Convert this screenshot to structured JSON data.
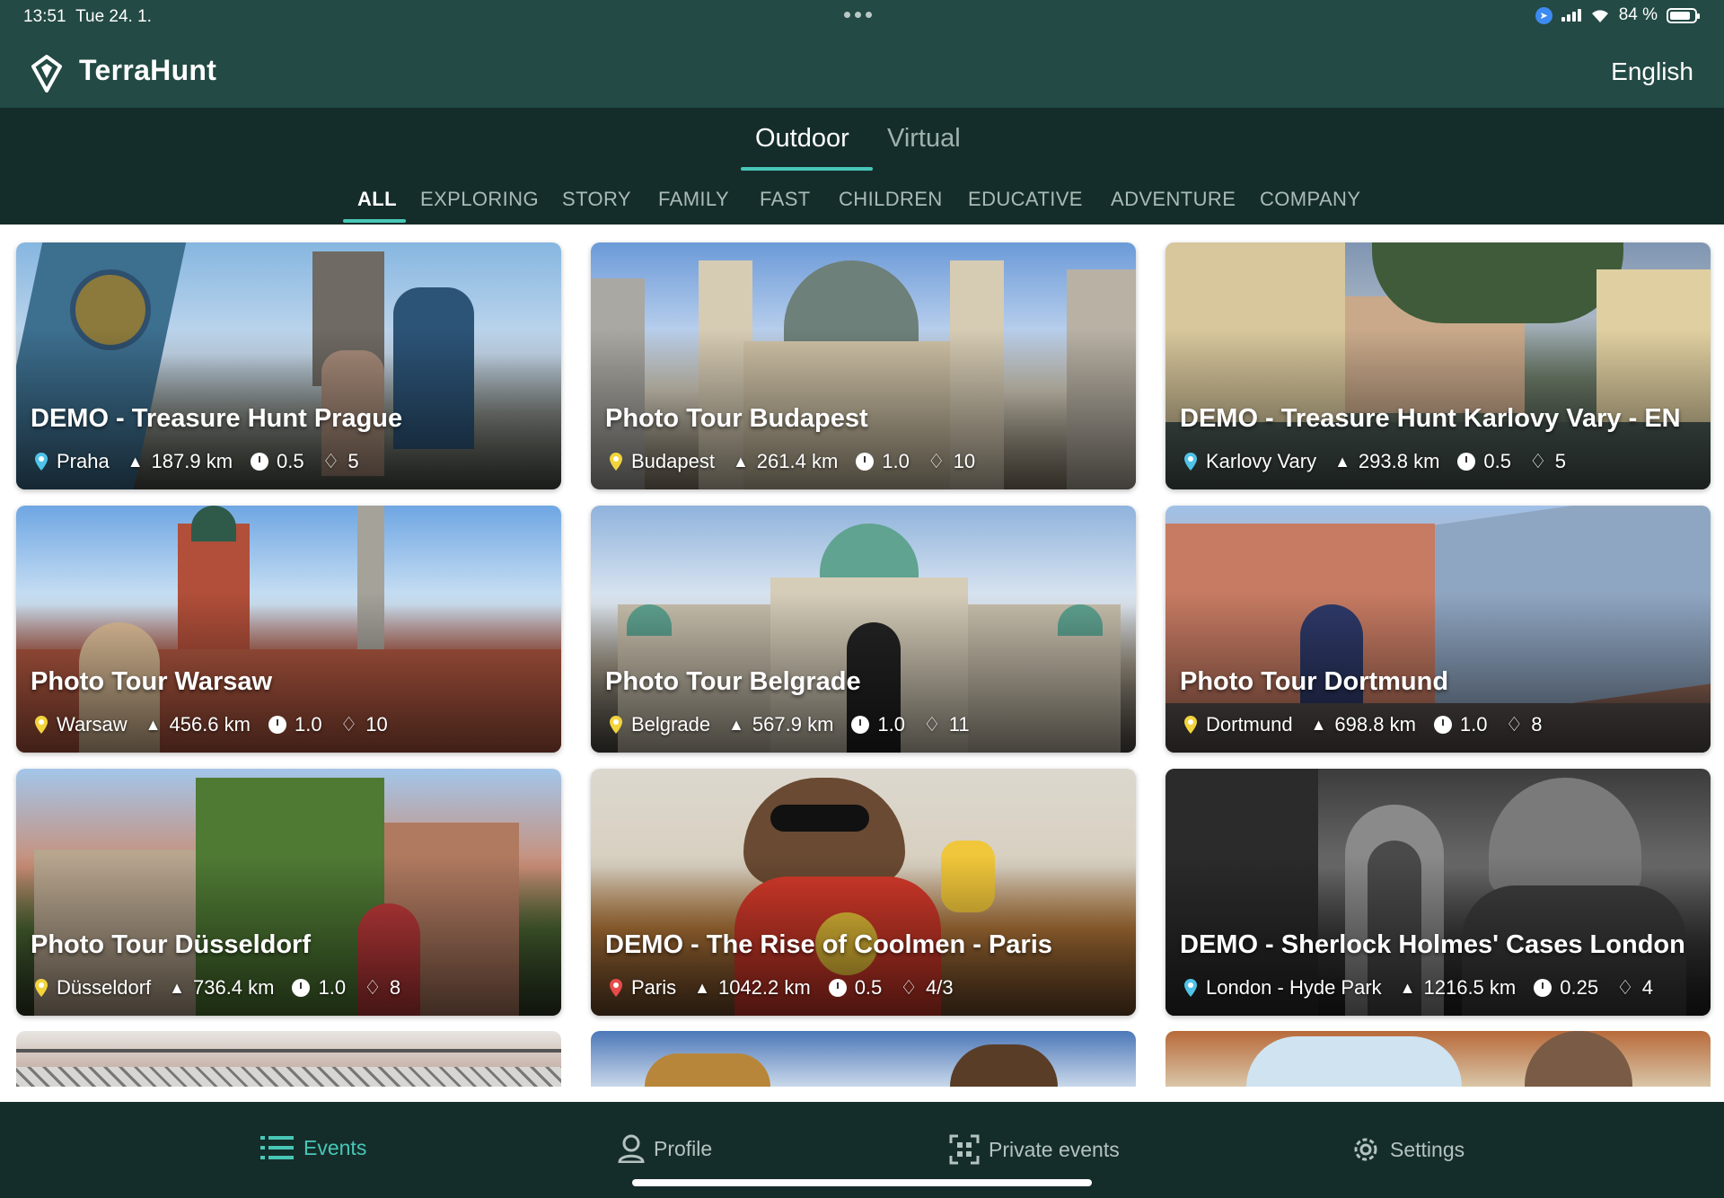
{
  "status": {
    "time": "13:51",
    "date": "Tue 24. 1.",
    "battery": "84 %",
    "battery_level": 0.84
  },
  "header": {
    "app_name": "TerraHunt",
    "language": "English"
  },
  "main_tabs": [
    {
      "label": "Outdoor",
      "active": true
    },
    {
      "label": "Virtual",
      "active": false
    }
  ],
  "categories": [
    {
      "label": "ALL",
      "active": true
    },
    {
      "label": "EXPLORING"
    },
    {
      "label": "STORY"
    },
    {
      "label": "FAMILY"
    },
    {
      "label": "FAST"
    },
    {
      "label": "CHILDREN"
    },
    {
      "label": "EDUCATIVE"
    },
    {
      "label": "ADVENTURE"
    },
    {
      "label": "COMPANY"
    }
  ],
  "cards": [
    {
      "title": "DEMO - Treasure Hunt Prague",
      "location": "Praha",
      "distance": "187.9 km",
      "duration": "0.5",
      "points": "5",
      "pin_color": "#4fc3e8"
    },
    {
      "title": "Photo Tour Budapest",
      "location": "Budapest",
      "distance": "261.4 km",
      "duration": "1.0",
      "points": "10",
      "pin_color": "#f2d43c"
    },
    {
      "title": "DEMO - Treasure Hunt Karlovy Vary - EN",
      "location": "Karlovy Vary",
      "distance": "293.8 km",
      "duration": "0.5",
      "points": "5",
      "pin_color": "#4fc3e8"
    },
    {
      "title": "Photo Tour Warsaw",
      "location": "Warsaw",
      "distance": "456.6 km",
      "duration": "1.0",
      "points": "10",
      "pin_color": "#f2d43c"
    },
    {
      "title": "Photo Tour Belgrade",
      "location": "Belgrade",
      "distance": "567.9 km",
      "duration": "1.0",
      "points": "11",
      "pin_color": "#f2d43c"
    },
    {
      "title": "Photo Tour Dortmund",
      "location": "Dortmund",
      "distance": "698.8 km",
      "duration": "1.0",
      "points": "8",
      "pin_color": "#f2d43c"
    },
    {
      "title": "Photo Tour Düsseldorf",
      "location": "Düsseldorf",
      "distance": "736.4 km",
      "duration": "1.0",
      "points": "8",
      "pin_color": "#f2d43c"
    },
    {
      "title": "DEMO - The Rise of Coolmen - Paris",
      "location": "Paris",
      "distance": "1042.2 km",
      "duration": "0.5",
      "points": "4/3",
      "pin_color": "#e84a4a"
    },
    {
      "title": "DEMO - Sherlock Holmes' Cases London",
      "location": "London - Hyde Park",
      "distance": "1216.5 km",
      "duration": "0.25",
      "points": "4",
      "pin_color": "#4fc3e8"
    }
  ],
  "bottom_nav": [
    {
      "label": "Events",
      "icon": "list-icon",
      "active": true
    },
    {
      "label": "Profile",
      "icon": "user-icon"
    },
    {
      "label": "Private events",
      "icon": "qr-icon"
    },
    {
      "label": "Settings",
      "icon": "gear-icon"
    }
  ],
  "colors": {
    "accent": "#48c7b7",
    "header_bg": "#234a44",
    "nav_bg": "#152d2a"
  }
}
